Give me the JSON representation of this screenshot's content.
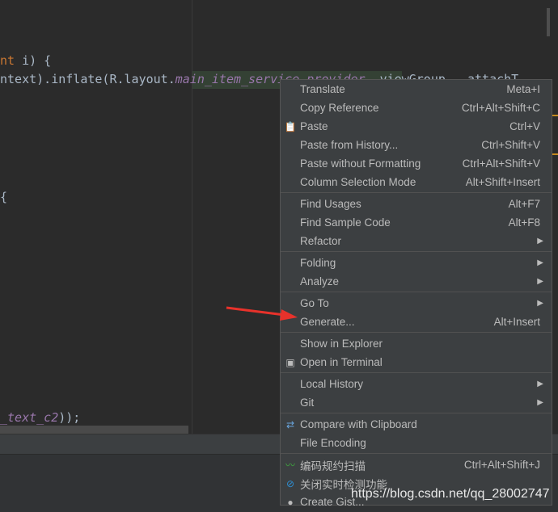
{
  "editor": {
    "lines": [
      {
        "pre": "",
        "kw": "nt",
        "rest": " i) {",
        "fld": ""
      },
      {
        "pre": "ntext).inflate(R.layout.",
        "fld": "main_item_service_provider",
        "rest": ", viewGroup,  attachT"
      },
      {
        "pre": "{"
      },
      {
        "fld": "_text_c2",
        "rest": "));"
      }
    ]
  },
  "menu": {
    "items": [
      {
        "label": "Translate",
        "shortcut": "Meta+I"
      },
      {
        "label": "Copy Reference",
        "shortcut": "Ctrl+Alt+Shift+C"
      },
      {
        "label": "Paste",
        "shortcut": "Ctrl+V",
        "icon": "clipboard-icon"
      },
      {
        "label": "Paste from History...",
        "shortcut": "Ctrl+Shift+V"
      },
      {
        "label": "Paste without Formatting",
        "shortcut": "Ctrl+Alt+Shift+V"
      },
      {
        "label": "Column Selection Mode",
        "shortcut": "Alt+Shift+Insert"
      },
      {
        "label": "Find Usages",
        "shortcut": "Alt+F7"
      },
      {
        "label": "Find Sample Code",
        "shortcut": "Alt+F8"
      },
      {
        "label": "Refactor",
        "submenu": true
      },
      {
        "label": "Folding",
        "submenu": true
      },
      {
        "label": "Analyze",
        "submenu": true
      },
      {
        "label": "Go To",
        "submenu": true
      },
      {
        "label": "Generate...",
        "shortcut": "Alt+Insert"
      },
      {
        "label": "Show in Explorer"
      },
      {
        "label": "Open in Terminal",
        "icon": "terminal-icon"
      },
      {
        "label": "Local History",
        "submenu": true
      },
      {
        "label": "Git",
        "submenu": true
      },
      {
        "label": "Compare with Clipboard",
        "icon": "compare-icon"
      },
      {
        "label": "File Encoding"
      },
      {
        "label": "编码规约扫描",
        "shortcut": "Ctrl+Alt+Shift+J",
        "icon": "scan-icon"
      },
      {
        "label": "关闭实时检测功能",
        "icon": "disable-icon"
      },
      {
        "label": "Create Gist...",
        "icon": "github-icon"
      }
    ],
    "separators_after": [
      5,
      8,
      10,
      12,
      14,
      16,
      18
    ]
  },
  "watermark": "https://blog.csdn.net/qq_28002747",
  "colors": {
    "arrow": "#e8322b",
    "menu_bg": "#3c3f41",
    "editor_bg": "#2b2b2b"
  }
}
